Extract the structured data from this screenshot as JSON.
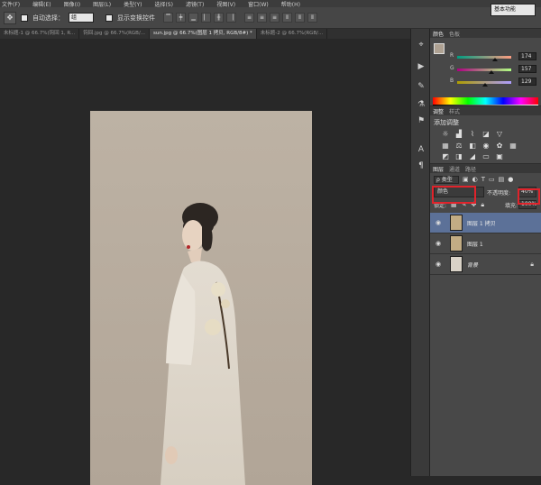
{
  "menu": [
    "文件(F)",
    "编辑(E)",
    "图像(I)",
    "图层(L)",
    "类型(Y)",
    "选择(S)",
    "滤镜(T)",
    "视图(V)",
    "窗口(W)",
    "帮助(H)"
  ],
  "options_bar": {
    "auto_select_label": "自动选择：",
    "auto_select_value": "组",
    "show_transform_label": "显示变换控件",
    "workspace": "基本功能"
  },
  "tabs": [
    {
      "label": "未标题-1 @ 66.7%(钩回 1, R...",
      "active": false
    },
    {
      "label": "钩回.jpg @ 66.7%(RGB/...",
      "active": false
    },
    {
      "label": "sun.jpg @ 66.7%(图层 1 拷贝, RGB/8#) *",
      "active": true
    },
    {
      "label": "未标题-2 @ 66.7%(RGB/...",
      "active": false
    }
  ],
  "color_panel": {
    "tabs": [
      "颜色",
      "色板"
    ],
    "r_label": "R",
    "g_label": "G",
    "b_label": "B",
    "r": "174",
    "g": "157",
    "b": "129",
    "fg_color": "#ae9d81"
  },
  "adjustments_panel": {
    "tabs": [
      "调整",
      "样式"
    ],
    "title": "添加调整"
  },
  "layers_panel": {
    "tabs": [
      "图层",
      "通道",
      "路径"
    ],
    "filter_kind": "ρ 类型",
    "blend_mode": "颜色",
    "opacity_label": "不透明度:",
    "opacity": "40%",
    "lock_label": "锁定:",
    "fill_label": "填充:",
    "fill": "100%",
    "layers": [
      {
        "name": "图层 1 拷贝",
        "selected": true,
        "thumb": "#c2ac84"
      },
      {
        "name": "图层 1",
        "selected": false,
        "thumb": "#c2ac84"
      },
      {
        "name": "背景",
        "selected": false,
        "thumb": "#d9d2c7",
        "locked": true
      }
    ]
  }
}
